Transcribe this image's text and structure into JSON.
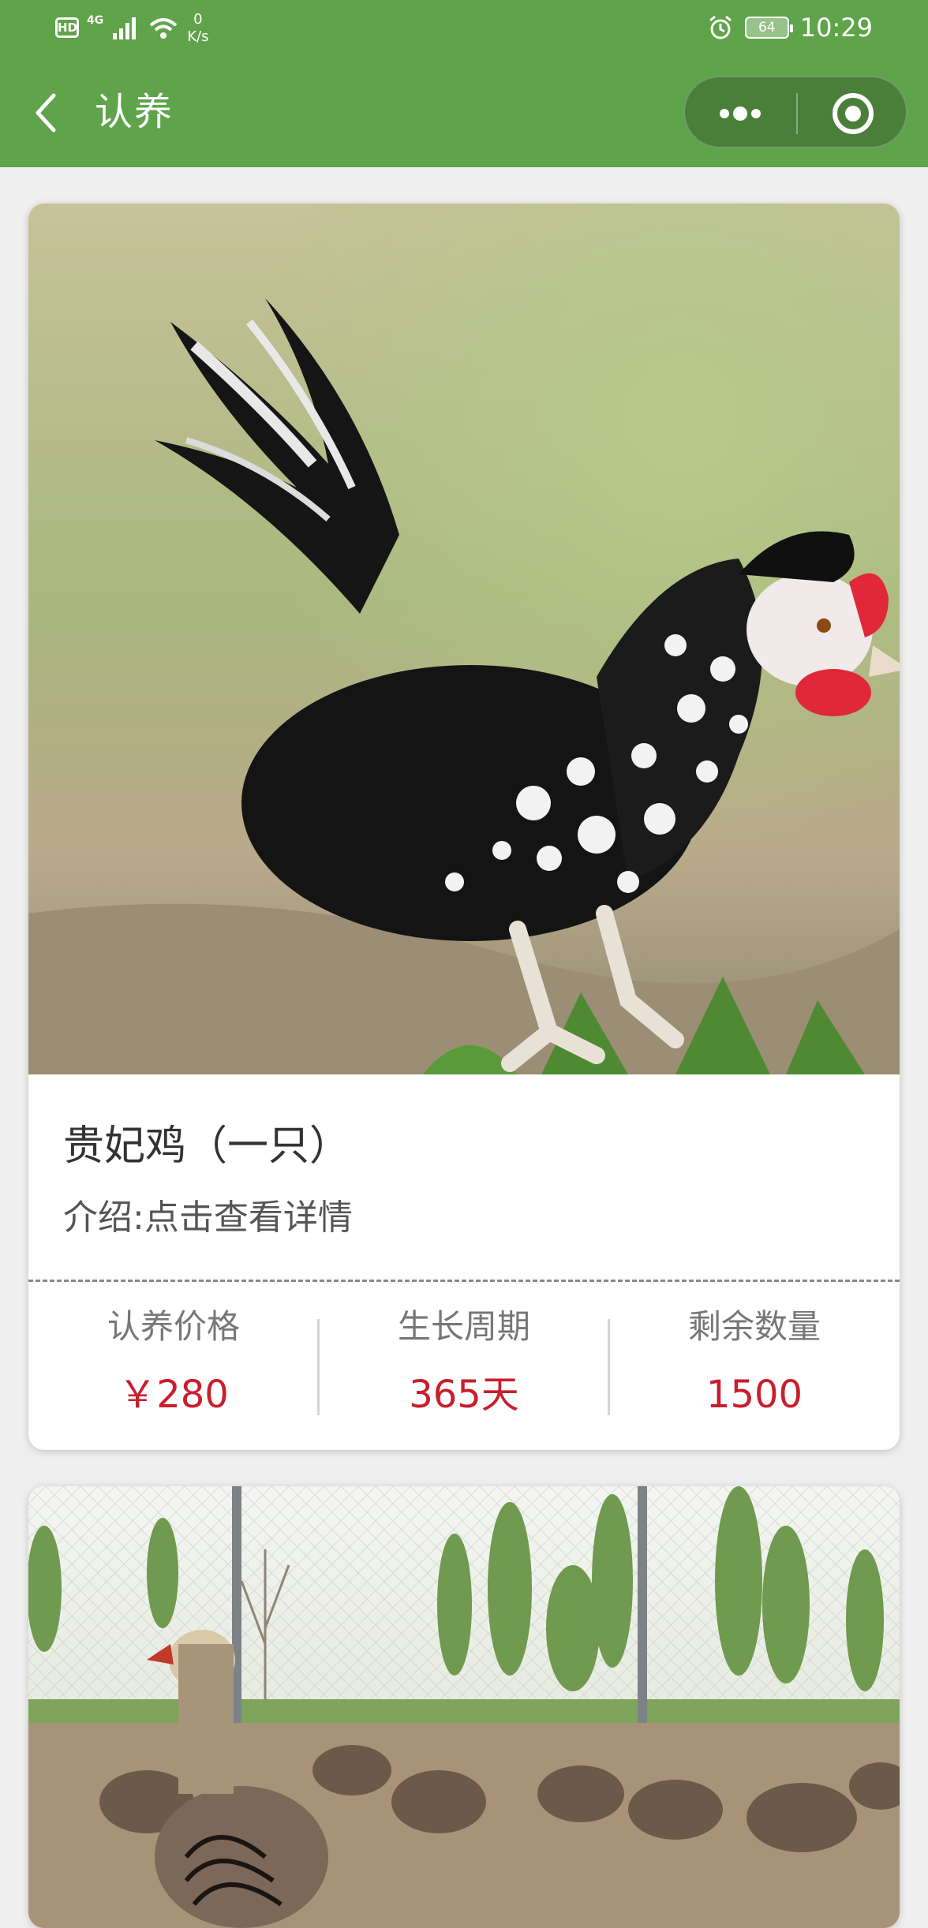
{
  "status_bar": {
    "hd": "HD",
    "network": "4G",
    "speed_value": "0",
    "speed_unit": "K/s",
    "battery": "64",
    "time": "10:29"
  },
  "nav": {
    "title": "认养"
  },
  "products": [
    {
      "name": "贵妃鸡（一只）",
      "intro": "介绍:点击查看详情",
      "stats": [
        {
          "label": "认养价格",
          "value": "￥280"
        },
        {
          "label": "生长周期",
          "value": "365天"
        },
        {
          "label": "剩余数量",
          "value": "1500"
        }
      ]
    }
  ],
  "colors": {
    "header_green": "#5fa34a",
    "price_red": "#c91e2e",
    "background": "#efefef"
  }
}
